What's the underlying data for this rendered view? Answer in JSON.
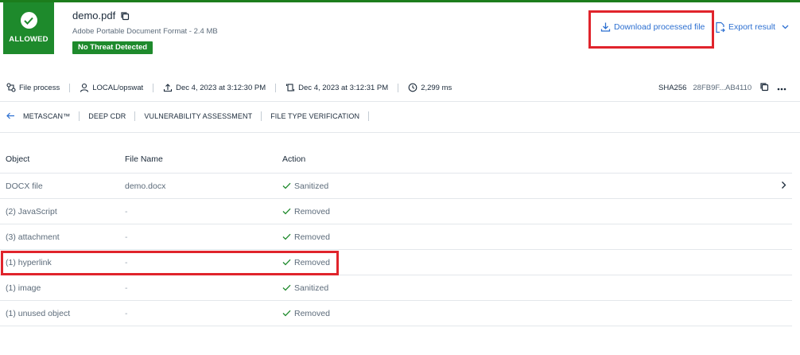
{
  "header": {
    "verdict_label": "ALLOWED",
    "file_name": "demo.pdf",
    "file_type": "Adobe Portable Document Format - 2.4 MB",
    "threat_badge": "No Threat Detected",
    "download_label": "Download processed file",
    "export_label": "Export result"
  },
  "meta": {
    "process_label": "File process",
    "user": "LOCAL/opswat",
    "start_time": "Dec 4, 2023 at 3:12:30 PM",
    "end_time": "Dec 4, 2023 at 3:12:31 PM",
    "duration": "2,299 ms",
    "sha_label": "SHA256",
    "sha_value": "28FB9F...AB4110"
  },
  "tabs": [
    "METASCAN™",
    "DEEP CDR",
    "VULNERABILITY ASSESSMENT",
    "FILE TYPE VERIFICATION"
  ],
  "table": {
    "headers": {
      "object": "Object",
      "file_name": "File Name",
      "action": "Action"
    },
    "rows": [
      {
        "object": "DOCX file",
        "file_name": "demo.docx",
        "action": "Sanitized"
      },
      {
        "object": "(2)  JavaScript",
        "file_name": "-",
        "action": "Removed"
      },
      {
        "object": "(3)  attachment",
        "file_name": "-",
        "action": "Removed"
      },
      {
        "object": "(1)  hyperlink",
        "file_name": "-",
        "action": "Removed"
      },
      {
        "object": "(1)  image",
        "file_name": "-",
        "action": "Sanitized"
      },
      {
        "object": "(1)  unused object",
        "file_name": "-",
        "action": "Removed"
      }
    ]
  },
  "colors": {
    "allowed_green": "#1e8a2c",
    "link_blue": "#2c6fd1",
    "highlight_red": "#e0242c"
  }
}
